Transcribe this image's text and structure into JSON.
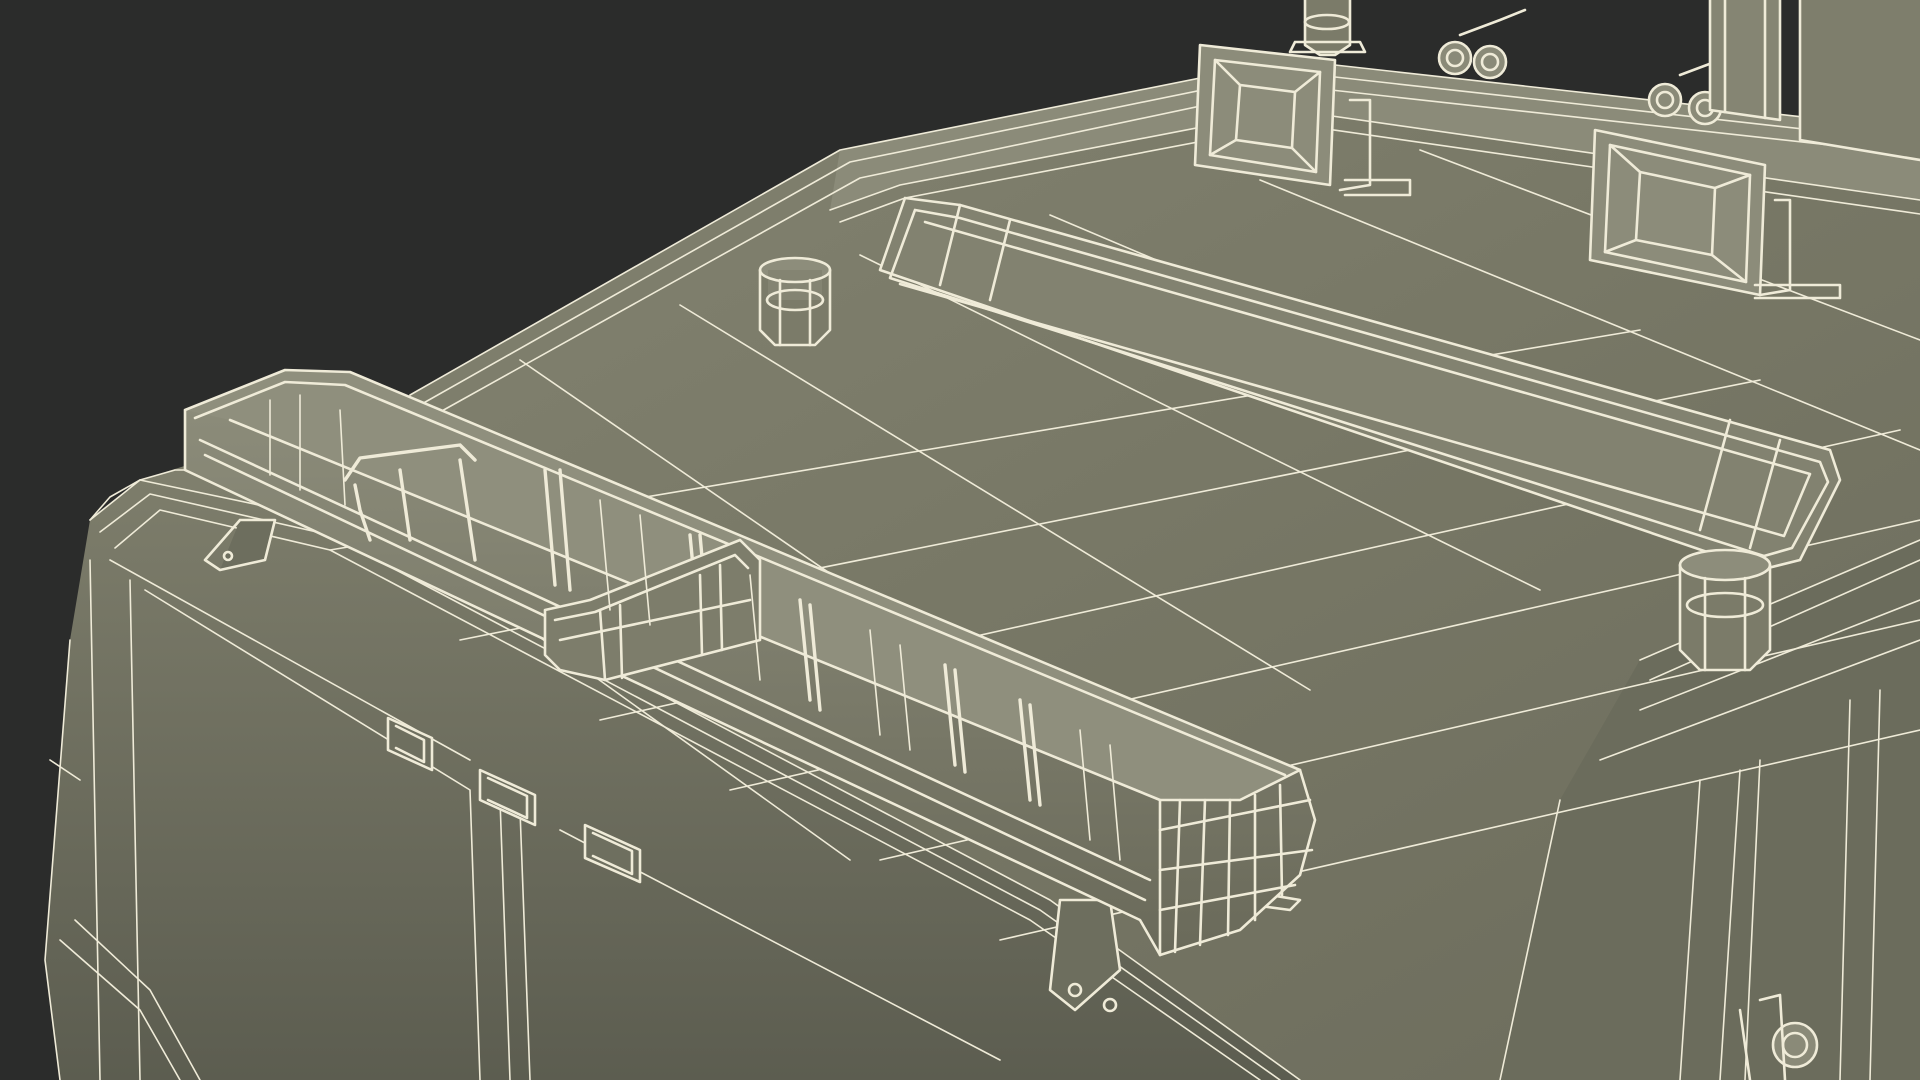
{
  "scene": {
    "subject": "wireframe-render-vehicle-roof",
    "colors": {
      "background": "#2b2c2b",
      "roof_surface": "#7a7a69",
      "roof_shadow": "#5f6052",
      "roof_light": "#8a8a78",
      "wire": "#efebd8"
    }
  }
}
